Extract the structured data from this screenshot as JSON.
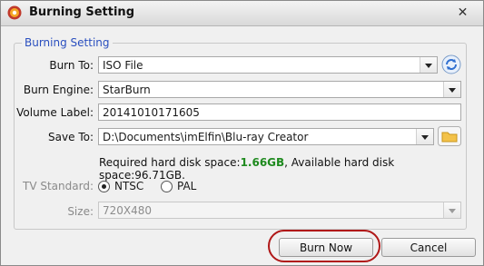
{
  "window": {
    "title": "Burning Setting",
    "close_glyph": "✕"
  },
  "group": {
    "legend": "Burning Setting"
  },
  "burn_to": {
    "label": "Burn To:",
    "value": "ISO File"
  },
  "burn_engine": {
    "label": "Burn Engine:",
    "value": "StarBurn"
  },
  "volume_label": {
    "label": "Volume Label:",
    "value": "20141010171605"
  },
  "save_to": {
    "label": "Save To:",
    "value": "D:\\Documents\\imElfin\\Blu-ray Creator"
  },
  "disk_info": {
    "required_prefix": "Required hard disk space:",
    "required_value": "1.66GB",
    "available_text": ", Available hard disk space:96.71GB."
  },
  "tv_standard": {
    "label": "TV Standard:",
    "options": [
      {
        "label": "NTSC",
        "selected": true
      },
      {
        "label": "PAL",
        "selected": false
      }
    ]
  },
  "size": {
    "label": "Size:",
    "value": "720X480"
  },
  "buttons": {
    "burn_now": "Burn Now",
    "cancel": "Cancel"
  },
  "colors": {
    "legend": "#2a4fbf",
    "required_value": "#1f8a1f",
    "highlight": "#b01818"
  },
  "icons": {
    "app": "app-logo-icon",
    "refresh": "refresh-icon",
    "folder": "folder-icon"
  }
}
